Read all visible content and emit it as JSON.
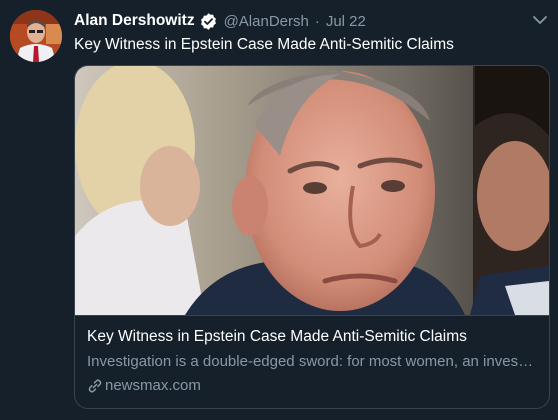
{
  "tweet": {
    "author_name": "Alan Dershowitz",
    "handle": "@AlanDersh",
    "separator": "·",
    "date": "Jul 22",
    "text": "Key Witness in Epstein Case Made Anti-Semitic Claims"
  },
  "card": {
    "title": "Key Witness in Epstein Case Made Anti-Semitic Claims",
    "description": "Investigation is a double-edged sword: for most women, an investigation of Epstein's victims…",
    "domain": "newsmax.com"
  },
  "colors": {
    "background": "#15202b",
    "secondary_text": "#8899a6",
    "border": "#38444d",
    "verified": "#ffffff"
  },
  "icons": {
    "verified": "verified-badge-icon",
    "caret": "chevron-down-icon",
    "link": "link-icon"
  }
}
